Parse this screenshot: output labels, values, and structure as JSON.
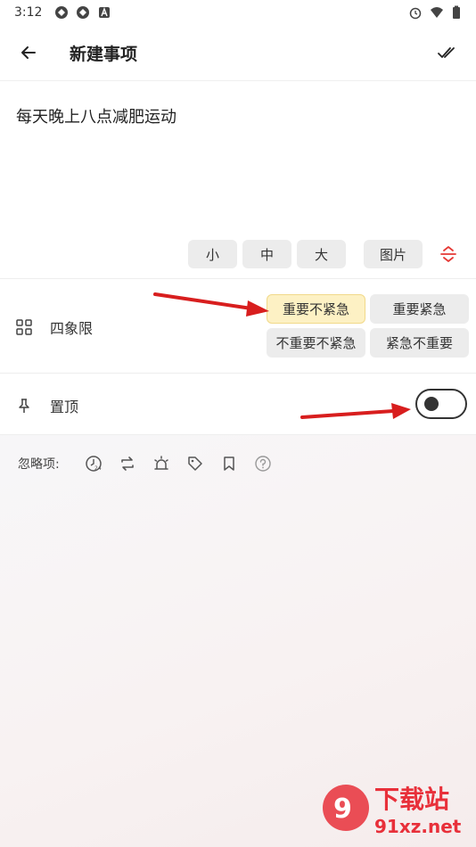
{
  "status_bar": {
    "time": "3:12"
  },
  "header": {
    "title": "新建事项"
  },
  "note": {
    "text": "每天晚上八点减肥运动"
  },
  "size_options": [
    "小",
    "中",
    "大"
  ],
  "image_button": "图片",
  "quadrant": {
    "label": "四象限",
    "options": [
      "重要不紧急",
      "重要紧急",
      "不重要不紧急",
      "紧急不重要"
    ],
    "selected": "重要不紧急"
  },
  "pin": {
    "label": "置顶",
    "enabled": false
  },
  "ignore": {
    "label": "忽略项:",
    "icons": [
      "clock-24h-icon",
      "repeat-icon",
      "alarm-icon",
      "tag-icon",
      "bookmark-icon",
      "help-icon"
    ]
  },
  "watermark": {
    "text": "下载站",
    "url": "91xz.net"
  },
  "colors": {
    "accent_red": "#e53935",
    "selected_bg": "#fdf1c4"
  }
}
